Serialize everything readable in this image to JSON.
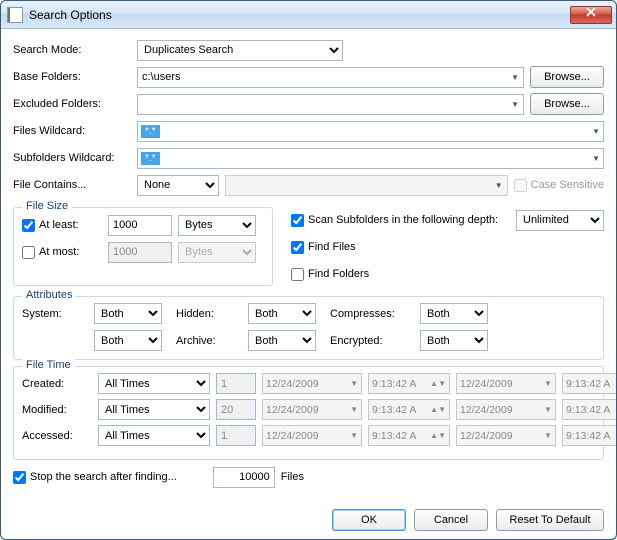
{
  "window": {
    "title": "Search Options"
  },
  "labels": {
    "search_mode": "Search Mode:",
    "base_folders": "Base Folders:",
    "excluded_folders": "Excluded Folders:",
    "files_wildcard": "Files Wildcard:",
    "subfolders_wildcard": "Subfolders Wildcard:",
    "file_contains": "File Contains...",
    "case_sensitive": "Case Sensitive",
    "file_size": "File Size",
    "at_least": "At least:",
    "at_most": "At most:",
    "scan_subfolders": "Scan Subfolders in the following depth:",
    "find_files": "Find Files",
    "find_folders": "Find Folders",
    "attributes": "Attributes",
    "system": "System:",
    "hidden": "Hidden:",
    "compresses": "Compresses:",
    "archive": "Archive:",
    "encrypted": "Encrypted:",
    "file_time": "File Time",
    "created": "Created:",
    "modified": "Modified:",
    "accessed": "Accessed:",
    "stop_after": "Stop the search after finding...",
    "files_suffix": "Files",
    "browse": "Browse...",
    "ok": "OK",
    "cancel": "Cancel",
    "reset": "Reset To Default"
  },
  "values": {
    "search_mode": "Duplicates Search",
    "base_folders": "c:\\users",
    "excluded_folders": "",
    "files_wildcard": "*.*",
    "subfolders_wildcard": "*.*",
    "file_contains_mode": "None",
    "file_contains_text": "",
    "case_sensitive": false,
    "at_least_checked": true,
    "at_least_value": "1000",
    "at_least_unit": "Bytes",
    "at_most_checked": false,
    "at_most_value": "1000",
    "at_most_unit": "Bytes",
    "scan_subfolders_checked": true,
    "scan_depth": "Unlimited",
    "find_files": true,
    "find_folders": false,
    "attr_system": "Both",
    "attr_hidden": "Both",
    "attr_compresses": "Both",
    "attr_unnamed": "Both",
    "attr_archive": "Both",
    "attr_encrypted": "Both",
    "time_created_mode": "All Times",
    "time_created_n": "1",
    "time_modified_mode": "All Times",
    "time_modified_n": "20",
    "time_accessed_mode": "All Times",
    "time_accessed_n": "1",
    "date1": "12/24/2009",
    "time1": "9:13:42 A",
    "date2": "12/24/2009",
    "time2": "9:13:42 A",
    "stop_after_checked": true,
    "stop_after_value": "10000"
  }
}
